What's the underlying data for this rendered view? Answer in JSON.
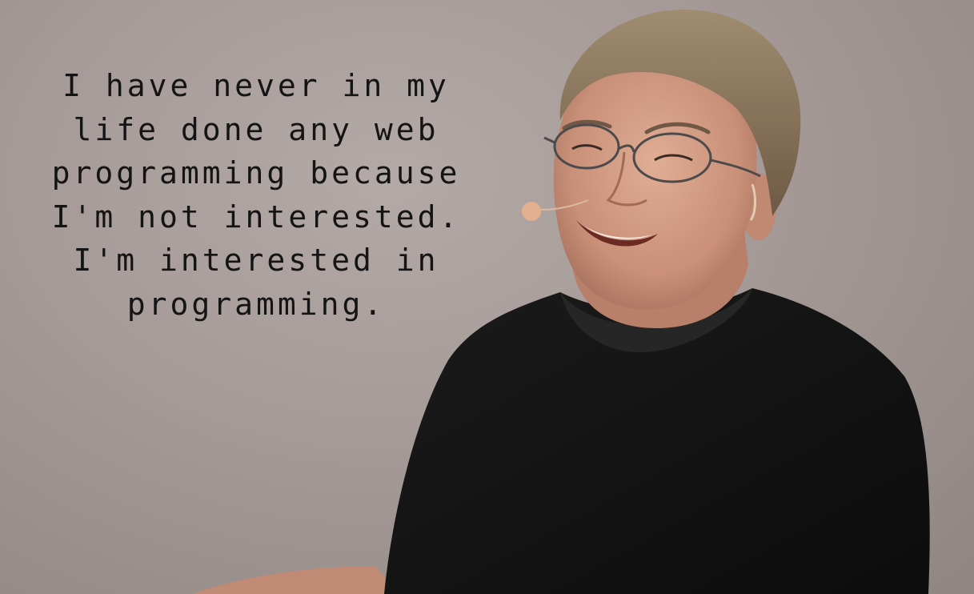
{
  "quote": {
    "lines": [
      "I have never in my",
      "life done any web",
      "programming because",
      "I'm not interested.",
      "I'm interested in",
      "programming."
    ]
  },
  "photo": {
    "subject": "smiling man with glasses, headset microphone, black t-shirt",
    "colors": {
      "background": "#a59a97",
      "shirt": "#121212",
      "skin": "#d09a84",
      "hair": "#8a7356"
    }
  }
}
